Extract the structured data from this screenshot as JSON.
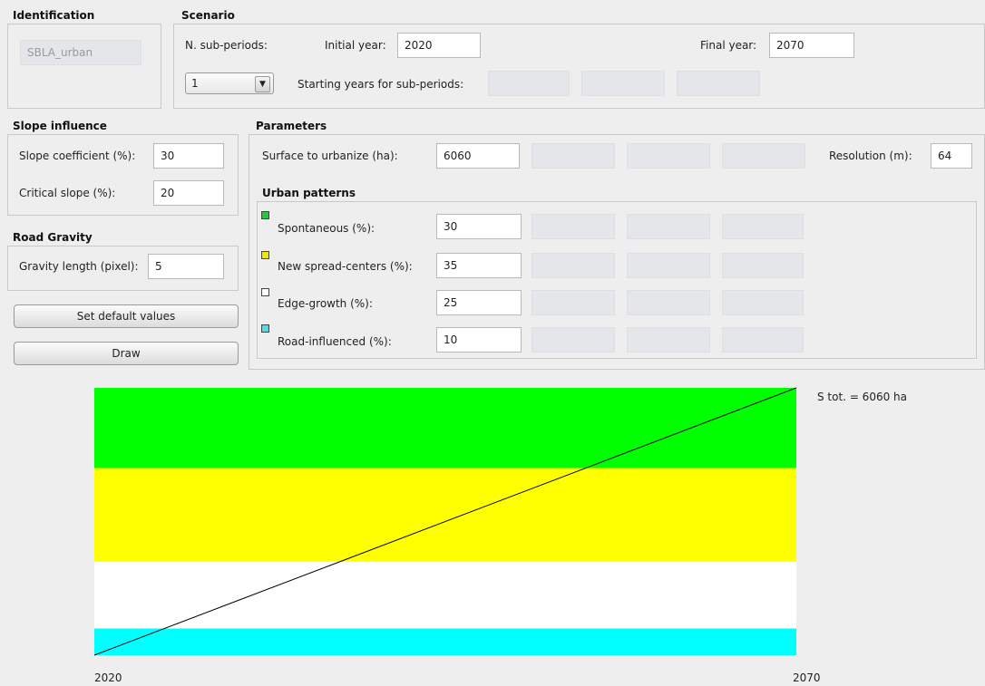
{
  "identification": {
    "title": "Identification",
    "name_value": "SBLA_urban"
  },
  "scenario": {
    "title": "Scenario",
    "n_subperiods_label": "N. sub-periods:",
    "initial_year_label": "Initial year:",
    "initial_year": "2020",
    "final_year_label": "Final year:",
    "final_year": "2070",
    "subperiods_selected": "1",
    "starting_years_label": "Starting years for sub-periods:"
  },
  "slope": {
    "title": "Slope influence",
    "coef_label": "Slope coefficient (%):",
    "coef_value": "30",
    "critical_label": "Critical slope (%):",
    "critical_value": "20"
  },
  "road": {
    "title": "Road Gravity",
    "gravity_label": "Gravity length (pixel):",
    "gravity_value": "5"
  },
  "buttons": {
    "defaults": "Set default values",
    "draw": "Draw"
  },
  "parameters": {
    "title": "Parameters",
    "surface_label": "Surface to urbanize (ha):",
    "surface_value": "6060",
    "resolution_label": "Resolution (m):",
    "resolution_value": "64"
  },
  "patterns": {
    "title": "Urban patterns",
    "items": [
      {
        "label": "Spontaneous (%):",
        "value": "30",
        "color": "#22c93b"
      },
      {
        "label": "New spread-centers (%):",
        "value": "35",
        "color": "#f2e600"
      },
      {
        "label": "Edge-growth (%):",
        "value": "25",
        "color": "#ffffff"
      },
      {
        "label": "Road-influenced (%):",
        "value": "10",
        "color": "#3fe3ee"
      }
    ]
  },
  "chart_data": {
    "type": "area",
    "x": [
      2020,
      2070
    ],
    "xlim": [
      2020,
      2070
    ],
    "ylim": [
      0,
      6060
    ],
    "tick_labels": [
      "2020",
      "2070"
    ],
    "annotation": "S tot. = 6060 ha",
    "series": [
      {
        "name": "Road-influenced",
        "share": 10,
        "color": "#00ffff"
      },
      {
        "name": "Edge-growth",
        "share": 25,
        "color": "#ffffff"
      },
      {
        "name": "New spread-centers",
        "share": 35,
        "color": "#ffff00"
      },
      {
        "name": "Spontaneous",
        "share": 30,
        "color": "#00ff00"
      }
    ],
    "line": {
      "x": [
        2020,
        2070
      ],
      "y": [
        0,
        6060
      ],
      "color": "#000000"
    }
  }
}
